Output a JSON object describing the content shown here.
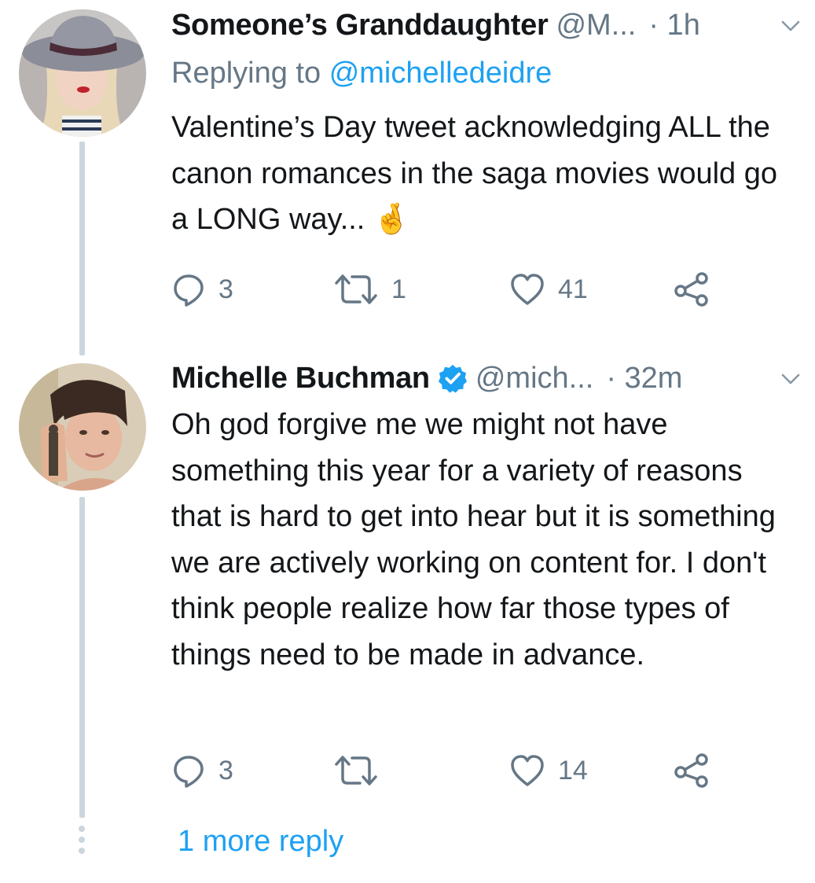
{
  "tweets": [
    {
      "name": "Someone’s Granddaughter",
      "handle": "@M...",
      "time": "· 1h",
      "replying_prefix": "Replying to",
      "replying_to": "@michelledeidre",
      "text": "Valentine’s Day tweet acknowledging ALL the canon romances in the saga movies would go a LONG way... 🤞",
      "reply_count": "3",
      "retweet_count": "1",
      "like_count": "41"
    },
    {
      "name": "Michelle Buchman",
      "handle": "@mich...",
      "time": "· 32m",
      "verified": true,
      "text": "Oh god forgive me we might not have something this year for a variety of reasons that is hard to get into hear but it is something we are actively working on content for. I don't think people realize how far those types of things need to be made in advance.",
      "reply_count": "3",
      "retweet_count": "",
      "like_count": "14"
    }
  ],
  "more_replies": "1 more reply",
  "colors": {
    "text": "#14171a",
    "secondary": "#657786",
    "link": "#1da1f2",
    "thread_line": "#ccd6dd"
  }
}
